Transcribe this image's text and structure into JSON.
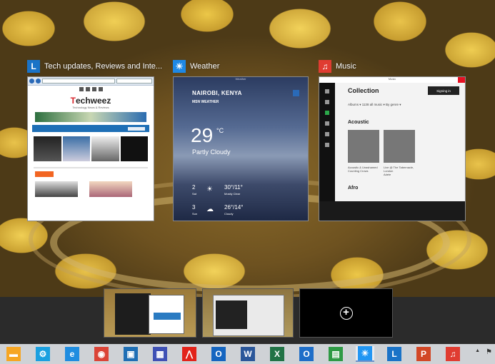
{
  "windows": [
    {
      "id": "browser",
      "title": "Tech updates, Reviews and Inte...",
      "icon": "browser-pin-icon",
      "icon_color": "#1a73c7",
      "site_logo": "echweez",
      "site_logo_prefix": "T",
      "site_tagline": "Technology News & Reviews"
    },
    {
      "id": "weather",
      "title": "Weather",
      "icon": "weather-sun-icon",
      "icon_color": "#1e88e5",
      "app_title": "Weather",
      "city": "NAIROBI, KENYA",
      "source": "MSN WEATHER",
      "temperature": "29",
      "unit": "°C",
      "condition": "Partly Cloudy",
      "forecast": [
        {
          "day": "2",
          "dname": "Sat",
          "high_low": "30°/11°",
          "desc": "Mostly Clear"
        },
        {
          "day": "3",
          "dname": "Sun",
          "high_low": "26°/14°",
          "desc": "Cloudy"
        }
      ]
    },
    {
      "id": "music",
      "title": "Music",
      "icon": "headphones-icon",
      "icon_color": "#e03c31",
      "app_title": "Music",
      "collection": "Collection",
      "sign_in": "Signing in",
      "filters": "Albums ▾   1138 all music ▾   By genre ▾",
      "sections": [
        "Acoustic",
        "Afro"
      ],
      "albums": [
        {
          "title": "Acoustic & Unashamed",
          "artist": "Counting Crows"
        },
        {
          "title": "Live @ The Tabernacle, London",
          "artist": "Adele"
        }
      ]
    }
  ],
  "desktops": {
    "add_label": "+"
  },
  "taskbar": {
    "items": [
      {
        "name": "file-explorer-icon",
        "glyph": "▬",
        "color": "#f6a623"
      },
      {
        "name": "settings-gear-icon",
        "glyph": "⚙",
        "color": "#1aa0e0"
      },
      {
        "name": "internet-explorer-icon",
        "glyph": "e",
        "color": "#1f8de0"
      },
      {
        "name": "chrome-icon",
        "glyph": "◉",
        "color": "#db4437"
      },
      {
        "name": "photo-app-icon",
        "glyph": "▣",
        "color": "#1f6fb5"
      },
      {
        "name": "calculator-icon",
        "glyph": "▦",
        "color": "#3f51b5"
      },
      {
        "name": "pdf-reader-icon",
        "glyph": "⋀",
        "color": "#e2231a"
      },
      {
        "name": "outlook-icon",
        "glyph": "O",
        "color": "#1565c0"
      },
      {
        "name": "word-icon",
        "glyph": "W",
        "color": "#2b579a"
      },
      {
        "name": "excel-icon",
        "glyph": "X",
        "color": "#217346"
      },
      {
        "name": "outlook-2-icon",
        "glyph": "O",
        "color": "#1e6ec8"
      },
      {
        "name": "store-icon",
        "glyph": "▤",
        "color": "#2e9a45"
      },
      {
        "name": "weather-icon",
        "glyph": "☀",
        "color": "#2196f3"
      },
      {
        "name": "browser-pin-icon",
        "glyph": "L",
        "color": "#1a73c7"
      },
      {
        "name": "powerpoint-icon",
        "glyph": "P",
        "color": "#d24726"
      },
      {
        "name": "music-headphones-icon",
        "glyph": "♫",
        "color": "#e03c31"
      }
    ],
    "active_index": 12
  }
}
